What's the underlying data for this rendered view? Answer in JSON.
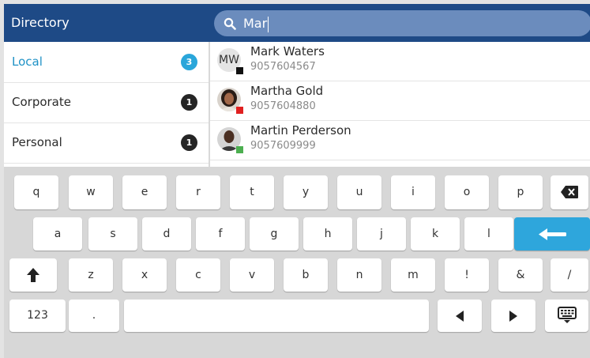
{
  "header": {
    "title": "Directory"
  },
  "search": {
    "value": "Mar",
    "icon": "search-icon"
  },
  "categories": [
    {
      "label": "Local",
      "count": "3",
      "active": true
    },
    {
      "label": "Corporate",
      "count": "1",
      "active": false
    },
    {
      "label": "Personal",
      "count": "1",
      "active": false
    }
  ],
  "contacts": [
    {
      "name": "Mark Waters",
      "number": "9057604567",
      "initials": "MW",
      "status_color": "#111111"
    },
    {
      "name": "Martha Gold",
      "number": "9057604880",
      "status_color": "#e02020"
    },
    {
      "name": "Martin Perderson",
      "number": "9057609999",
      "status_color": "#4caf50"
    }
  ],
  "keyboard": {
    "row1": [
      "q",
      "w",
      "e",
      "r",
      "t",
      "y",
      "u",
      "i",
      "o",
      "p"
    ],
    "row2": [
      "a",
      "s",
      "d",
      "f",
      "g",
      "h",
      "j",
      "k",
      "l"
    ],
    "row3": [
      "z",
      "x",
      "c",
      "v",
      "b",
      "n",
      "m",
      "!",
      "&",
      "/"
    ],
    "numbers_label": "123",
    "period_label": "."
  },
  "colors": {
    "header": "#1e4a86",
    "accent": "#2aa6da",
    "enter": "#2ea6dc"
  }
}
